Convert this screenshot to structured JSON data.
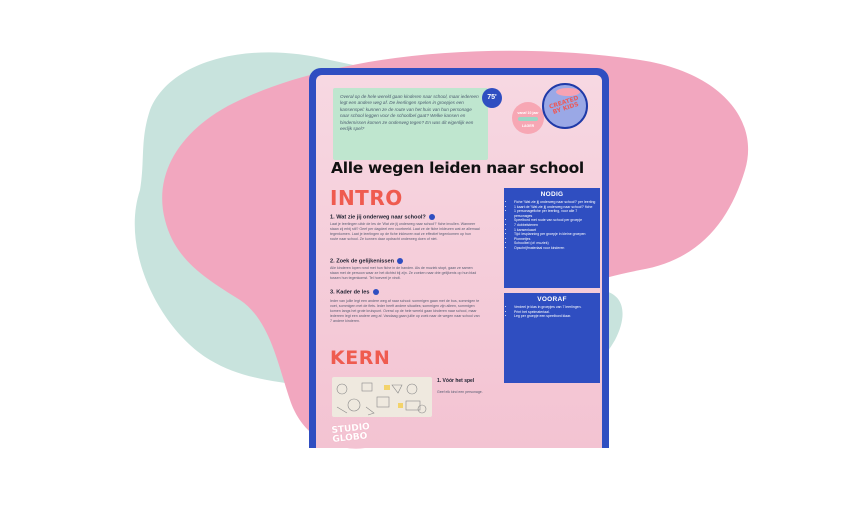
{
  "colors": {
    "blob_pink": "#f2a7bf",
    "blob_mint": "#c8e3dd",
    "frame_blue": "#2f4ec1",
    "accent_red": "#ef5b4f",
    "intro_box_green": "#bfe6cf"
  },
  "document": {
    "intro_text": "Overal op de hele wereld gaan kinderen naar school, maar iedereen legt een andere weg af. De leerlingen spelen in groepjes een kansenspel: kunnen ze de route van het huis van hun personage naar school leggen voor de schoolbel gaat? Welke kansen en hindernissen komen ze onderweg tegen? En was dit eigenlijk een eerlijk spel?",
    "minutes_badge": "75'",
    "age_badge_top": "vanaf 10 jaar",
    "age_badge_bottom": "LAGER",
    "created_badge": "CREATED BY KIDS",
    "title": "Alle wegen leiden naar school",
    "intro_heading": "INTRO",
    "step1_title": "1. Wat zie jij onderweg naar school?",
    "step1_body": "Laat je leerlingen uitdr de les de 'Wat zie jij onderweg naar school?' fiche invullen. Wanneer staan zij erbij stil? Geef per dagdeel een voorbeeld. Laat ze de fiche inkleuren wat ze allemaal tegenkomen. Laat je leerlingen op de fiche inkleuren wat ze effectief tegenkomen op hun route naar school. Ze kunnen daar opdracht onderweg doen of niet.",
    "step2_title": "2. Zoek de gelijkenissen",
    "step2_body": "Alle kinderen lopen rond met hun fiche in de handen. Als de muziek stopt, gaan ze samen staan met de persoon waar ze het dichtst bij zijn. Ze zoeken naar drie gelijkenis op hun blad tussen hun tegenkomst. Tel hoeveel je vindt.",
    "step3_title": "3. Kader de les",
    "step3_body": "Ieder van jullie legt een andere weg af naar school: sommigen gaan met de bus, sommigen te voet, sommigen met de fiets. Ieder heeft andere situaties; sommigen zijn alleen, sommigen komen langs het grote kruispunt. Overal op de hele wereld gaan kinderen naar school, maar iedereen legt een andere weg af. Vandaag gaan jullie op zoek naar de wegen naar school van 7 andere kinderen.",
    "nodig_title": "NODIG",
    "nodig_items": [
      "Fiche 'Wat zie jij onderweg naar school?' per leerling",
      "1 kaart de 'Wat zie jij onderweg naar school?' fiche",
      "1 personagefiche per leerling, voor alle 7 personages",
      "Speelbord met route van school per groepje",
      "7 dobbelstenen",
      "1 kansenkaart",
      "Tijd: lesplanning per groepje in kleine groepen",
      "Pionnetjes",
      "Schoolbel (of: muziek)",
      "Opschrijfmateriaal voor kinderen"
    ],
    "vooraf_title": "VOORAF",
    "vooraf_items": [
      "Verdeel je klas in groepjes van 7 leerlingen.",
      "Print het spelmateriaal.",
      "Leg per groepje een speelbord klaar."
    ],
    "kern_heading": "KERN",
    "kern_step1": "1. Vóór het spel",
    "kern_step1_body": "Geef elk kind een personage.",
    "logo_line1": "STUDIO",
    "logo_line2": "GLOBO"
  }
}
